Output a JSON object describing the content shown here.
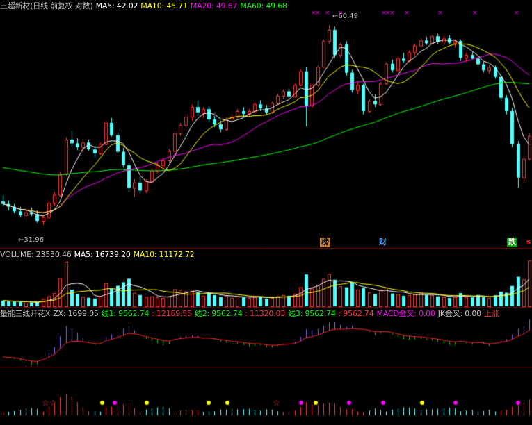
{
  "price_header": {
    "title": "三超新材(日线 前复权 对数)",
    "ma5": "MA5: 42.02",
    "ma10": "MA10: 45.71",
    "ma20": "MA20: 49.67",
    "ma60": "MA60: 49.68"
  },
  "volume_header": {
    "volume": "VOLUME: 23530.46",
    "ma5": "MA5: 16739.20",
    "ma10": "MA10: 11172.72"
  },
  "indicator_header": {
    "name": "量能三线开花X",
    "zx": "ZX: 1699.05",
    "line1": "线1: 9562.74",
    "val1": ": 12169.55",
    "line2": "线2: 9562.74",
    "val2": ": 11320.03",
    "line3": "线3: 9562.74",
    "val3": ": 9562.74",
    "macd": "MACD金叉: 0.00",
    "jk": "JK金叉: 0.00",
    "up": "上涨"
  },
  "badges": {
    "bang": "榜",
    "cai": "财",
    "die": "跌",
    "s": "s"
  },
  "annotations": {
    "high": "60.49",
    "low": "31.96"
  },
  "colors": {
    "up": "#ff3232",
    "down": "#54ffff",
    "ma5": "#ffffff",
    "ma10": "#ffff00",
    "ma20": "#ff00ff",
    "ma60": "#00ff00",
    "text": "#c0c0c0",
    "grid": "#800000"
  },
  "chart_data": {
    "type": "candlestick",
    "scale": "log",
    "ylim": [
      31.0,
      63.0
    ],
    "candles": [
      [
        34.5,
        35.2,
        34.0,
        34.2
      ],
      [
        34.2,
        34.6,
        33.5,
        33.9
      ],
      [
        33.9,
        34.2,
        33.2,
        33.4
      ],
      [
        33.4,
        33.9,
        32.8,
        33.0
      ],
      [
        33.0,
        33.6,
        32.5,
        33.3
      ],
      [
        33.3,
        33.8,
        32.9,
        33.1
      ],
      [
        33.1,
        33.5,
        32.2,
        32.4
      ],
      [
        32.4,
        33.0,
        31.96,
        32.8
      ],
      [
        32.8,
        34.5,
        32.6,
        34.3
      ],
      [
        34.3,
        35.5,
        34.0,
        35.2
      ],
      [
        35.2,
        37.9,
        35.0,
        37.6
      ],
      [
        37.6,
        42.3,
        37.4,
        42.0
      ],
      [
        42.0,
        43.2,
        41.0,
        41.5
      ],
      [
        41.5,
        42.2,
        40.6,
        41.0
      ],
      [
        41.0,
        41.8,
        40.3,
        41.6
      ],
      [
        41.6,
        42.0,
        40.5,
        40.7
      ],
      [
        40.7,
        41.2,
        39.6,
        40.2
      ],
      [
        40.2,
        41.6,
        40.0,
        41.4
      ],
      [
        41.4,
        44.6,
        41.2,
        44.3
      ],
      [
        44.3,
        45.0,
        42.4,
        42.6
      ],
      [
        42.6,
        43.0,
        40.2,
        40.4
      ],
      [
        40.4,
        40.9,
        38.4,
        38.7
      ],
      [
        38.7,
        39.0,
        35.5,
        36.0
      ],
      [
        36.0,
        37.0,
        35.0,
        36.6
      ],
      [
        36.6,
        37.3,
        35.3,
        35.7
      ],
      [
        35.7,
        37.0,
        35.4,
        36.8
      ],
      [
        36.8,
        38.3,
        36.5,
        38.0
      ],
      [
        38.0,
        39.0,
        37.7,
        38.7
      ],
      [
        38.7,
        39.6,
        38.0,
        39.3
      ],
      [
        39.3,
        40.8,
        39.0,
        40.5
      ],
      [
        40.5,
        43.2,
        40.2,
        42.8
      ],
      [
        42.8,
        44.3,
        42.5,
        44.0
      ],
      [
        44.0,
        45.6,
        43.6,
        45.2
      ],
      [
        45.2,
        47.0,
        44.6,
        46.6
      ],
      [
        46.6,
        47.6,
        45.3,
        45.8
      ],
      [
        45.8,
        46.6,
        45.0,
        46.3
      ],
      [
        46.3,
        46.8,
        44.4,
        44.8
      ],
      [
        44.8,
        45.3,
        43.7,
        44.1
      ],
      [
        44.1,
        44.6,
        43.0,
        43.4
      ],
      [
        43.4,
        45.1,
        43.2,
        44.9
      ],
      [
        44.9,
        45.6,
        44.3,
        45.2
      ],
      [
        45.2,
        46.3,
        44.9,
        46.0
      ],
      [
        46.0,
        46.6,
        45.1,
        45.6
      ],
      [
        45.6,
        46.3,
        45.2,
        46.0
      ],
      [
        46.0,
        47.3,
        45.7,
        47.0
      ],
      [
        47.0,
        47.6,
        46.0,
        46.4
      ],
      [
        46.4,
        46.9,
        45.5,
        45.8
      ],
      [
        45.8,
        47.4,
        45.6,
        47.2
      ],
      [
        47.2,
        48.6,
        47.0,
        48.3
      ],
      [
        48.3,
        49.3,
        47.8,
        49.0
      ],
      [
        49.0,
        49.4,
        47.9,
        48.2
      ],
      [
        48.2,
        50.2,
        48.0,
        50.0
      ],
      [
        50.0,
        52.5,
        49.8,
        52.2
      ],
      [
        52.2,
        53.0,
        43.8,
        46.8
      ],
      [
        46.8,
        50.2,
        46.5,
        50.0
      ],
      [
        50.0,
        53.2,
        49.8,
        53.0
      ],
      [
        53.0,
        57.8,
        52.8,
        57.5
      ],
      [
        57.5,
        60.49,
        57.0,
        59.6
      ],
      [
        59.6,
        60.2,
        54.5,
        55.0
      ],
      [
        55.0,
        57.2,
        54.5,
        56.9
      ],
      [
        56.9,
        57.5,
        51.5,
        52.0
      ],
      [
        52.0,
        52.5,
        48.8,
        49.2
      ],
      [
        49.2,
        50.5,
        48.5,
        50.0
      ],
      [
        50.0,
        50.2,
        45.5,
        46.0
      ],
      [
        46.0,
        47.8,
        45.7,
        47.5
      ],
      [
        47.5,
        48.5,
        46.6,
        47.0
      ],
      [
        47.0,
        50.5,
        46.8,
        50.2
      ],
      [
        50.2,
        53.8,
        50.0,
        53.5
      ],
      [
        53.5,
        54.2,
        52.0,
        52.4
      ],
      [
        52.4,
        54.7,
        52.0,
        54.4
      ],
      [
        54.4,
        55.4,
        53.7,
        54.0
      ],
      [
        54.0,
        55.8,
        53.8,
        55.5
      ],
      [
        55.5,
        57.0,
        55.0,
        56.7
      ],
      [
        56.7,
        58.0,
        56.2,
        57.6
      ],
      [
        57.6,
        58.3,
        56.8,
        57.1
      ],
      [
        57.1,
        58.6,
        56.9,
        58.4
      ],
      [
        58.4,
        58.9,
        57.0,
        57.4
      ],
      [
        57.4,
        58.4,
        56.8,
        58.0
      ],
      [
        58.0,
        58.6,
        56.9,
        57.2
      ],
      [
        57.2,
        57.8,
        56.3,
        57.5
      ],
      [
        57.5,
        57.8,
        54.0,
        54.5
      ],
      [
        54.5,
        55.4,
        53.8,
        55.0
      ],
      [
        55.0,
        55.6,
        54.2,
        54.4
      ],
      [
        54.4,
        54.7,
        53.0,
        53.4
      ],
      [
        53.4,
        53.8,
        52.0,
        52.4
      ],
      [
        52.4,
        53.4,
        51.8,
        52.9
      ],
      [
        52.9,
        53.2,
        51.0,
        51.3
      ],
      [
        51.3,
        51.6,
        47.5,
        48.0
      ],
      [
        48.0,
        48.4,
        45.5,
        46.0
      ],
      [
        46.0,
        46.5,
        41.0,
        41.4
      ],
      [
        41.4,
        41.8,
        36.0,
        37.2
      ],
      [
        37.2,
        39.8,
        36.6,
        39.5
      ],
      [
        39.5,
        42.8,
        39.3,
        42.5
      ]
    ],
    "volume": [
      [
        2900,
        "d"
      ],
      [
        2600,
        "d"
      ],
      [
        2400,
        "d"
      ],
      [
        2200,
        "d"
      ],
      [
        1800,
        "u"
      ],
      [
        1900,
        "d"
      ],
      [
        2100,
        "d"
      ],
      [
        3800,
        "u"
      ],
      [
        5200,
        "u"
      ],
      [
        6800,
        "u"
      ],
      [
        14500,
        "u"
      ],
      [
        23000,
        "u"
      ],
      [
        8600,
        "d"
      ],
      [
        6400,
        "d"
      ],
      [
        4900,
        "u"
      ],
      [
        4400,
        "d"
      ],
      [
        4000,
        "d"
      ],
      [
        5200,
        "u"
      ],
      [
        11800,
        "u"
      ],
      [
        9100,
        "d"
      ],
      [
        10600,
        "d"
      ],
      [
        12400,
        "d"
      ],
      [
        14200,
        "d"
      ],
      [
        7000,
        "u"
      ],
      [
        5800,
        "d"
      ],
      [
        4800,
        "u"
      ],
      [
        5100,
        "u"
      ],
      [
        4600,
        "u"
      ],
      [
        4300,
        "u"
      ],
      [
        5200,
        "u"
      ],
      [
        8800,
        "u"
      ],
      [
        8400,
        "u"
      ],
      [
        7700,
        "u"
      ],
      [
        8000,
        "u"
      ],
      [
        7300,
        "d"
      ],
      [
        5400,
        "u"
      ],
      [
        6600,
        "d"
      ],
      [
        5800,
        "d"
      ],
      [
        4800,
        "d"
      ],
      [
        5300,
        "u"
      ],
      [
        4400,
        "u"
      ],
      [
        5100,
        "u"
      ],
      [
        4600,
        "d"
      ],
      [
        4300,
        "u"
      ],
      [
        4800,
        "u"
      ],
      [
        5000,
        "d"
      ],
      [
        3900,
        "d"
      ],
      [
        4300,
        "u"
      ],
      [
        5200,
        "u"
      ],
      [
        5800,
        "u"
      ],
      [
        5400,
        "d"
      ],
      [
        6400,
        "u"
      ],
      [
        9800,
        "u"
      ],
      [
        16400,
        "d"
      ],
      [
        9200,
        "u"
      ],
      [
        10800,
        "u"
      ],
      [
        14200,
        "u"
      ],
      [
        16700,
        "u"
      ],
      [
        13700,
        "d"
      ],
      [
        10300,
        "u"
      ],
      [
        9800,
        "d"
      ],
      [
        12400,
        "d"
      ],
      [
        8600,
        "u"
      ],
      [
        9400,
        "d"
      ],
      [
        7200,
        "u"
      ],
      [
        6300,
        "d"
      ],
      [
        8700,
        "u"
      ],
      [
        9600,
        "u"
      ],
      [
        6600,
        "d"
      ],
      [
        6000,
        "u"
      ],
      [
        5400,
        "d"
      ],
      [
        5800,
        "u"
      ],
      [
        6300,
        "u"
      ],
      [
        6800,
        "u"
      ],
      [
        5700,
        "d"
      ],
      [
        5700,
        "u"
      ],
      [
        5100,
        "d"
      ],
      [
        4800,
        "u"
      ],
      [
        4300,
        "d"
      ],
      [
        4800,
        "u"
      ],
      [
        6800,
        "d"
      ],
      [
        4800,
        "u"
      ],
      [
        4600,
        "d"
      ],
      [
        5800,
        "d"
      ],
      [
        4800,
        "d"
      ],
      [
        4200,
        "u"
      ],
      [
        5700,
        "d"
      ],
      [
        7500,
        "d"
      ],
      [
        7000,
        "d"
      ],
      [
        10500,
        "d"
      ],
      [
        15200,
        "d"
      ],
      [
        13900,
        "u"
      ],
      [
        23530,
        "u"
      ]
    ]
  }
}
